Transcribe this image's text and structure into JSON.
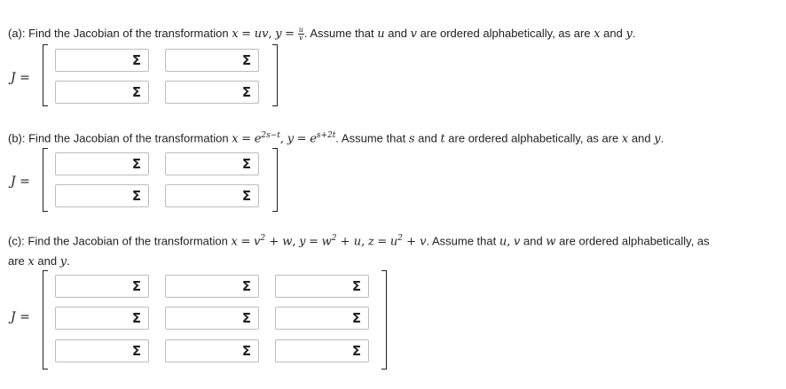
{
  "part_a": {
    "prefix": "(a): Find the Jacobian of the transformation",
    "eq_x_lhs": "x",
    "eq_x_rhs": "uv",
    "eq_y_lhs": "y",
    "frac_num": "u",
    "frac_den": "v",
    "suffix_1": ". Assume that",
    "var_1": "u",
    "and_1": "and",
    "var_2": "v",
    "suffix_2": "are ordered alphabetically, as are",
    "var_3": "x",
    "and_2": "and",
    "var_4": "y",
    "end": ".",
    "label": "J"
  },
  "part_b": {
    "prefix": "(b): Find the Jacobian of the transformation",
    "eq_x_lhs": "x",
    "base_1": "e",
    "exp_1": "2s−t",
    "eq_y_lhs": "y",
    "base_2": "e",
    "exp_2": "s+2t",
    "suffix_1": ". Assume that",
    "var_1": "s",
    "and_1": "and",
    "var_2": "t",
    "suffix_2": "are ordered alphabetically, as are",
    "var_3": "x",
    "and_2": "and",
    "var_4": "y",
    "end": ".",
    "label": "J"
  },
  "part_c": {
    "prefix": "(c): Find the Jacobian of the transformation",
    "eq_x_lhs": "x",
    "v_base": "v",
    "sq": "2",
    "plus_w": " + w",
    "eq_y_lhs": "y",
    "w_base": "w",
    "plus_u": " + u",
    "eq_z_lhs": "z",
    "u_base": "u",
    "plus_v": " + v",
    "suffix_1": ". Assume that",
    "var_1": "u",
    "var_2": "v",
    "and_1": "and",
    "var_3": "w",
    "suffix_2": "are ordered alphabetically, as",
    "line2_start": "are",
    "var_4": "x",
    "and_2": "and",
    "var_5": "y",
    "end": ".",
    "label": "J"
  },
  "equals": "=",
  "sigma_symbol": "Σ"
}
